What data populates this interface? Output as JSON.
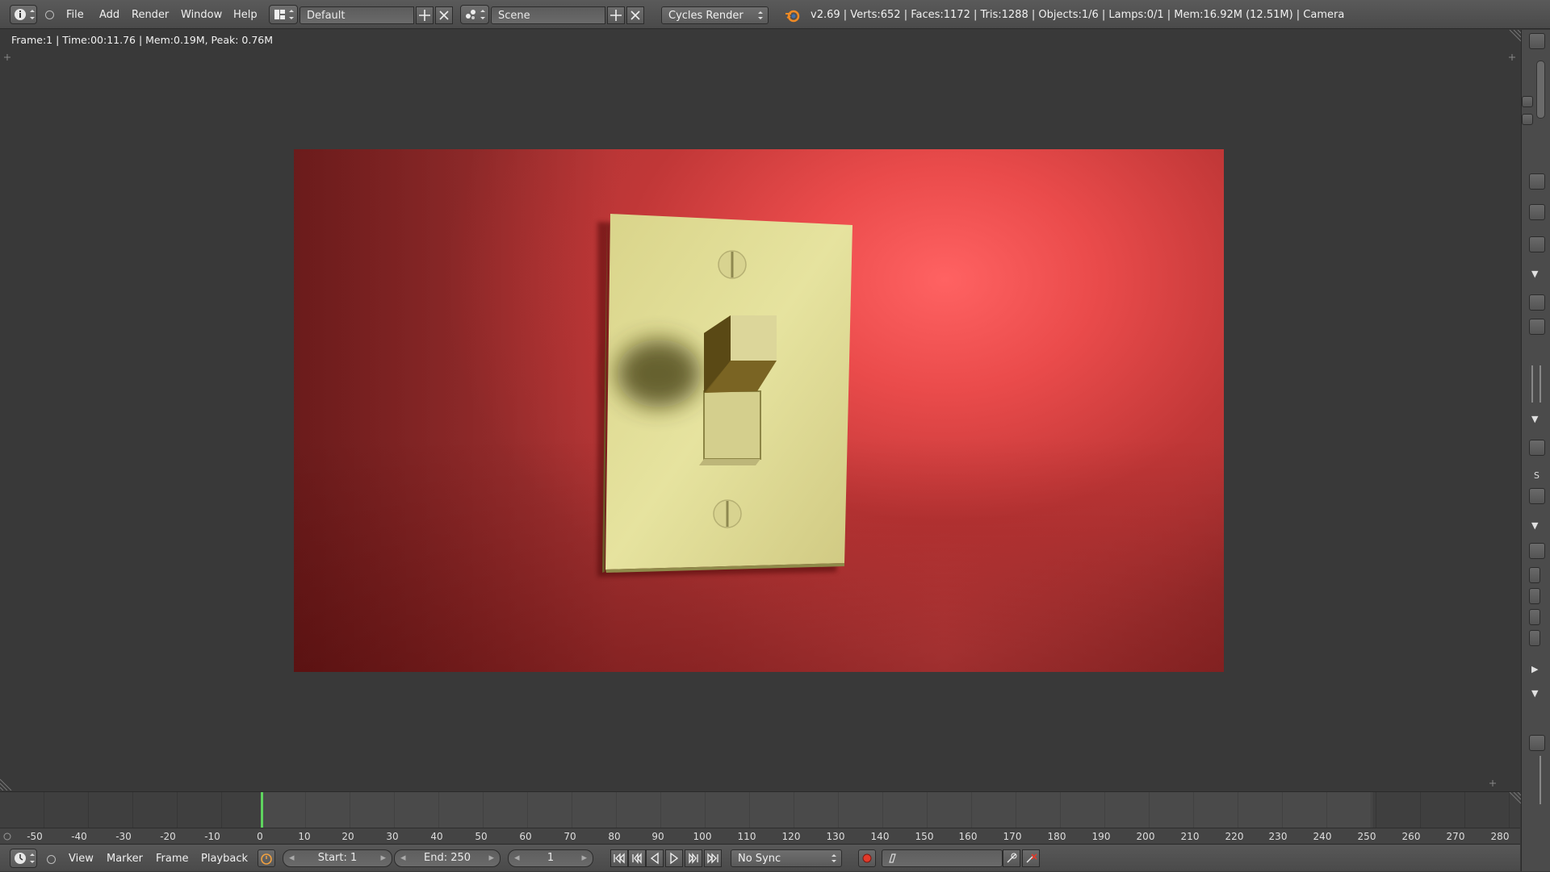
{
  "header": {
    "editor_type_icon": "info-icon",
    "menus": [
      "File",
      "Add",
      "Render",
      "Window",
      "Help"
    ],
    "screen_layout": "Default",
    "scene": "Scene",
    "render_engine": "Cycles Render",
    "info": "v2.69 | Verts:652 | Faces:1172 | Tris:1288 | Objects:1/6 | Lamps:0/1 | Mem:16.92M (12.51M) | Camera"
  },
  "viewport": {
    "render_stats": "Frame:1 | Time:00:11.76 | Mem:0.19M, Peak: 0.76M"
  },
  "right_strip": {
    "label_s": "S"
  },
  "timeline": {
    "ruler_ticks": [
      "-50",
      "-40",
      "-30",
      "-20",
      "-10",
      "0",
      "10",
      "20",
      "30",
      "40",
      "50",
      "60",
      "70",
      "80",
      "90",
      "100",
      "110",
      "120",
      "130",
      "140",
      "150",
      "160",
      "170",
      "180",
      "190",
      "200",
      "210",
      "220",
      "230",
      "240",
      "250",
      "260",
      "270",
      "280"
    ],
    "current_frame_marker": 1
  },
  "bottom": {
    "menus": [
      "View",
      "Marker",
      "Frame",
      "Playback"
    ],
    "start": "Start: 1",
    "end": "End: 250",
    "current_frame": "1",
    "sync": "No Sync"
  },
  "colors": {
    "background": "#393939",
    "render_red": "#e04646",
    "switch_plate": "#e8e49a",
    "playhead": "#5fd45f",
    "record": "#e23a2a"
  }
}
